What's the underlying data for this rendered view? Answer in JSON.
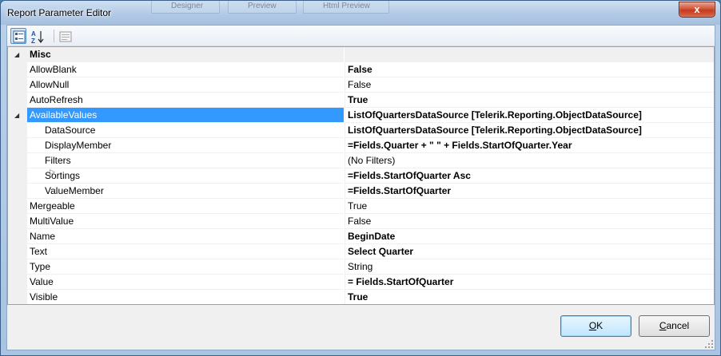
{
  "window": {
    "title": "Report Parameter Editor",
    "close_glyph": "x",
    "background_tabs": [
      "Designer",
      "Preview",
      "Html Preview"
    ]
  },
  "toolbar": {
    "buttons": [
      {
        "icon": "categorized-icon",
        "active": true
      },
      {
        "icon": "sort-alphabetical-icon",
        "active": false
      },
      {
        "icon": "property-pages-icon",
        "active": false
      }
    ]
  },
  "grid": {
    "category": {
      "label": "Misc",
      "expander": "◢"
    },
    "rows": [
      {
        "name": "AllowBlank",
        "value": "False",
        "bold": true
      },
      {
        "name": "AllowNull",
        "value": "False",
        "bold": false
      },
      {
        "name": "AutoRefresh",
        "value": "True",
        "bold": true
      },
      {
        "name": "AvailableValues",
        "value": "ListOfQuartersDataSource [Telerik.Reporting.ObjectDataSource]",
        "bold": true,
        "selected": true,
        "expander": "◢"
      },
      {
        "name": "DataSource",
        "value": "ListOfQuartersDataSource [Telerik.Reporting.ObjectDataSource]",
        "bold": true,
        "indent": 1
      },
      {
        "name": "DisplayMember",
        "value": "=Fields.Quarter + \" \" + Fields.StartOfQuarter.Year",
        "bold": true,
        "indent": 1
      },
      {
        "name": "Filters",
        "value": "(No Filters)",
        "bold": false,
        "indent": 1
      },
      {
        "name": "Sortings",
        "value": "=Fields.StartOfQuarter Asc",
        "bold": true,
        "indent": 1,
        "sub_expander": "▷"
      },
      {
        "name": "ValueMember",
        "value": "=Fields.StartOfQuarter",
        "bold": true,
        "indent": 1
      },
      {
        "name": "Mergeable",
        "value": "True",
        "bold": false
      },
      {
        "name": "MultiValue",
        "value": "False",
        "bold": false
      },
      {
        "name": "Name",
        "value": "BeginDate",
        "bold": true
      },
      {
        "name": "Text",
        "value": "Select Quarter",
        "bold": true
      },
      {
        "name": "Type",
        "value": "String",
        "bold": false
      },
      {
        "name": "Value",
        "value": "= Fields.StartOfQuarter",
        "bold": true
      },
      {
        "name": "Visible",
        "value": "True",
        "bold": true
      }
    ]
  },
  "footer": {
    "ok_label": "OK",
    "ok_mnemonic": "O",
    "ok_rest": "K",
    "cancel_label": "Cancel",
    "cancel_mnemonic": "C",
    "cancel_rest": "ancel"
  },
  "colors": {
    "selection": "#3399ff",
    "gutter": "#f0f0f0",
    "close_button": "#c33b1e"
  }
}
